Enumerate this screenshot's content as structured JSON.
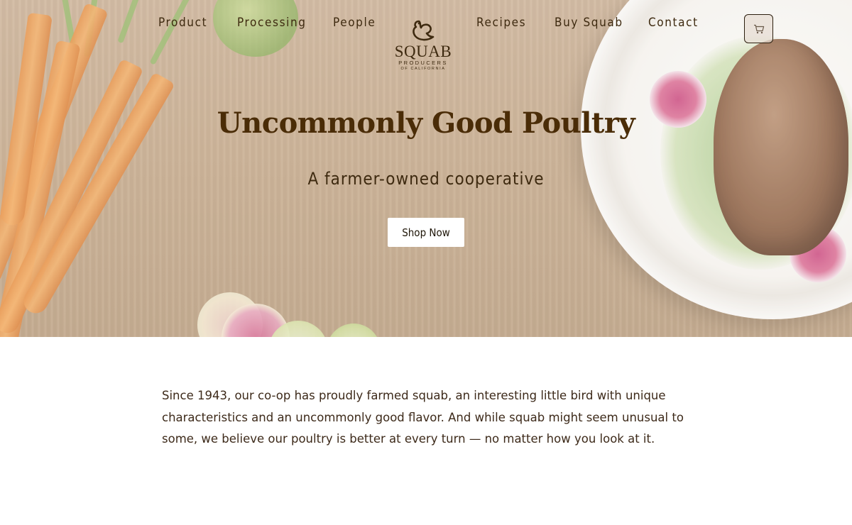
{
  "nav": {
    "items": [
      {
        "label": "Product"
      },
      {
        "label": "Processing"
      },
      {
        "label": "People"
      },
      {
        "label": "Recipes"
      },
      {
        "label": "Buy Squab"
      },
      {
        "label": "Contact"
      }
    ],
    "cart_icon": "shopping-cart-icon"
  },
  "logo": {
    "icon": "squab-bird-icon",
    "name": "SQUAB",
    "line1": "PRODUCERS",
    "line2": "OF CALIFORNIA"
  },
  "hero": {
    "title": "Uncommonly Good Poultry",
    "subtitle": "A farmer-owned cooperative",
    "cta_label": "Shop Now"
  },
  "intro": {
    "text": "Since 1943, our co-op has proudly farmed squab, an interesting little bird with unique characteristics and an uncommonly good flavor. And while squab might seem unusual to some, we believe our poultry is better at every turn — no matter how you look at it."
  },
  "colors": {
    "heading": "#4a2c07",
    "nav_text": "#3e2a10",
    "body_text": "#3d2a1a",
    "hero_wood": "#c2a483"
  }
}
